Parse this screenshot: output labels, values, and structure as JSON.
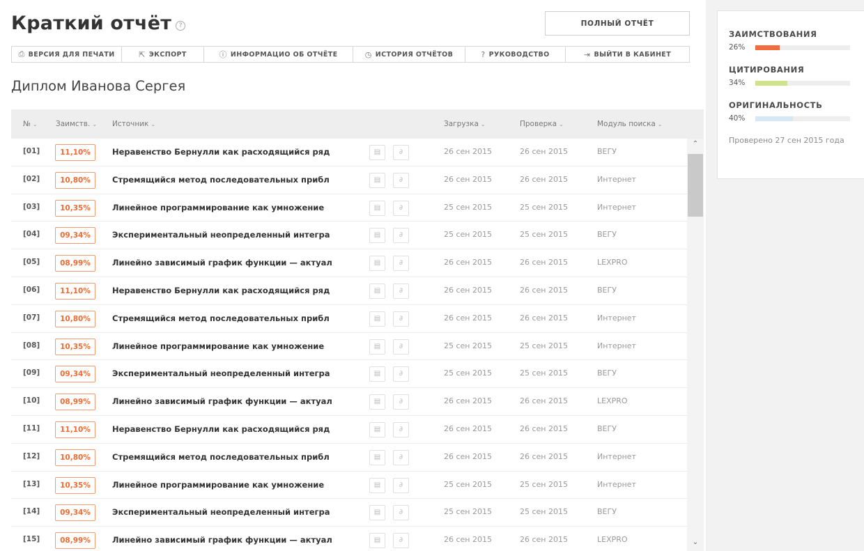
{
  "header": {
    "title": "Краткий отчёт",
    "help_icon": "question-circle-icon",
    "full_report_label": "ПОЛНЫЙ ОТЧЁТ"
  },
  "toolbar": [
    {
      "icon": "printer-icon",
      "glyph": "⎙",
      "label": "ВЕРСИЯ ДЛЯ ПЕЧАТИ"
    },
    {
      "icon": "export-icon",
      "glyph": "⇱",
      "label": "ЭКСПОРТ"
    },
    {
      "icon": "info-icon",
      "glyph": "ⓘ",
      "label": "ИНФОРМАЦИО ОБ ОТЧЁТЕ"
    },
    {
      "icon": "history-icon",
      "glyph": "◷",
      "label": "ИСТОРИЯ ОТЧЁТОВ"
    },
    {
      "icon": "help-icon",
      "glyph": "?",
      "label": "РУКОВОДСТВО"
    },
    {
      "icon": "logout-icon",
      "glyph": "⇥",
      "label": "ВЫЙТИ В КАБИНЕТ"
    }
  ],
  "document_title": "Диплом Иванова Сергея",
  "table": {
    "columns": {
      "num": "№",
      "borrow": "Заимств.",
      "source": "Источник",
      "load": "Загрузка",
      "check": "Проверка",
      "module": "Модуль поиска"
    },
    "rows": [
      {
        "num": "[01]",
        "pct": "11,10%",
        "source": "Неравенство Бернулли как расходящийся ряд",
        "load": "26 сен 2015",
        "check": "26 сен 2015",
        "module": "ВЕГУ"
      },
      {
        "num": "[02]",
        "pct": "10,80%",
        "source": "Стремящийся метод последовательных прибл",
        "load": "26 сен 2015",
        "check": "26 сен 2015",
        "module": "Интернет"
      },
      {
        "num": "[03]",
        "pct": "10,35%",
        "source": "Линейное программирование как умножение",
        "load": "25 сен 2015",
        "check": "25 сен 2015",
        "module": "Интернет"
      },
      {
        "num": "[04]",
        "pct": "09,34%",
        "source": "Экспериментальный неопределенный интегра",
        "load": "25 сен 2015",
        "check": "25 сен 2015",
        "module": "ВЕГУ"
      },
      {
        "num": "[05]",
        "pct": "08,99%",
        "source": "Линейно зависимый график функции — актуал",
        "load": "26 сен 2015",
        "check": "26 сен 2015",
        "module": "LEXPRO"
      },
      {
        "num": "[06]",
        "pct": "11,10%",
        "source": "Неравенство Бернулли как расходящийся ряд",
        "load": "26 сен 2015",
        "check": "26 сен 2015",
        "module": "ВЕГУ"
      },
      {
        "num": "[07]",
        "pct": "10,80%",
        "source": "Стремящийся метод последовательных прибл",
        "load": "26 сен 2015",
        "check": "26 сен 2015",
        "module": "Интернет"
      },
      {
        "num": "[08]",
        "pct": "10,35%",
        "source": "Линейное программирование как умножение",
        "load": "25 сен 2015",
        "check": "25 сен 2015",
        "module": "Интернет"
      },
      {
        "num": "[09]",
        "pct": "09,34%",
        "source": "Экспериментальный неопределенный интегра",
        "load": "25 сен 2015",
        "check": "25 сен 2015",
        "module": "ВЕГУ"
      },
      {
        "num": "[10]",
        "pct": "08,99%",
        "source": "Линейно зависимый график функции — актуал",
        "load": "26 сен 2015",
        "check": "26 сен 2015",
        "module": "LEXPRO"
      },
      {
        "num": "[11]",
        "pct": "11,10%",
        "source": "Неравенство Бернулли как расходящийся ряд",
        "load": "26 сен 2015",
        "check": "26 сен 2015",
        "module": "ВЕГУ"
      },
      {
        "num": "[12]",
        "pct": "10,80%",
        "source": "Стремящийся метод последовательных прибл",
        "load": "26 сен 2015",
        "check": "26 сен 2015",
        "module": "Интернет"
      },
      {
        "num": "[13]",
        "pct": "10,35%",
        "source": "Линейное программирование как умножение",
        "load": "25 сен 2015",
        "check": "25 сен 2015",
        "module": "Интернет"
      },
      {
        "num": "[14]",
        "pct": "09,34%",
        "source": "Экспериментальный неопределенный интегра",
        "load": "25 сен 2015",
        "check": "25 сен 2015",
        "module": "ВЕГУ"
      },
      {
        "num": "[15]",
        "pct": "08,99%",
        "source": "Линейно зависимый график функции — актуал",
        "load": "26 сен 2015",
        "check": "26 сен 2015",
        "module": "LEXPRO"
      }
    ]
  },
  "stats": [
    {
      "label": "ЗАИМСТВОВАНИЯ",
      "pct_text": "26%",
      "value": 0.26,
      "color": "#f26d3d"
    },
    {
      "label": "ЦИТИРОВАНИЯ",
      "pct_text": "34%",
      "value": 0.34,
      "color": "#cfe38b"
    },
    {
      "label": "ОРИГИНАЛЬНОСТЬ",
      "pct_text": "40%",
      "value": 0.4,
      "color": "#d6e8f7"
    }
  ],
  "checked_text": "Проверено 27 сен 2015 года",
  "colors": {
    "accent_orange": "#ef6b33",
    "badge_border": "#f29b6f",
    "header_bg": "#eeeeee",
    "sidebar_bg": "#f2f2f2"
  }
}
